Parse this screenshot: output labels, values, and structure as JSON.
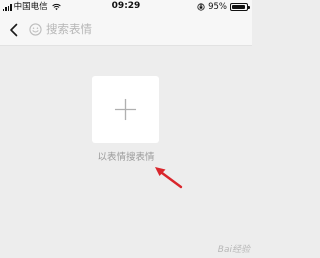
{
  "status_bar": {
    "carrier": "中国电信",
    "time": "09:29",
    "battery": "95%",
    "battery_level": 0.95
  },
  "search": {
    "placeholder": "搜索表情"
  },
  "main": {
    "add_hint": "以表情搜表情"
  },
  "watermark": "Bai经验",
  "icons": {
    "back": "chevron-left-icon",
    "emoji": "smiley-icon",
    "add": "plus-icon",
    "annotation": "red-arrow"
  },
  "colors": {
    "background": "#ededed",
    "bar": "#f7f7f7",
    "card": "#ffffff",
    "hint_text": "#9b9b9b",
    "annotation": "#d9262c"
  }
}
